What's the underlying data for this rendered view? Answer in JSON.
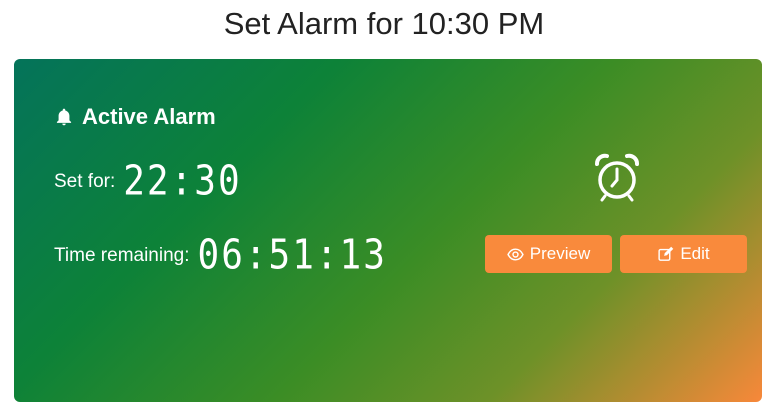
{
  "page": {
    "title": "Set Alarm for 10:30 PM"
  },
  "card": {
    "heading": "Active Alarm",
    "set_for_label": "Set for:",
    "set_for_value": "22:30",
    "remaining_label": "Time remaining:",
    "remaining_value": "06:51:13",
    "icons": {
      "heading": "bell-icon",
      "main": "alarm-clock-icon"
    }
  },
  "buttons": {
    "preview_label": "Preview",
    "edit_label": "Edit",
    "preview_icon": "eye-icon",
    "edit_icon": "edit-icon"
  },
  "colors": {
    "gradient_start": "#04735a",
    "gradient_mid": "#3b8d25",
    "gradient_end": "#f8883a",
    "button": "#f98a3c",
    "title_text": "#222222"
  }
}
